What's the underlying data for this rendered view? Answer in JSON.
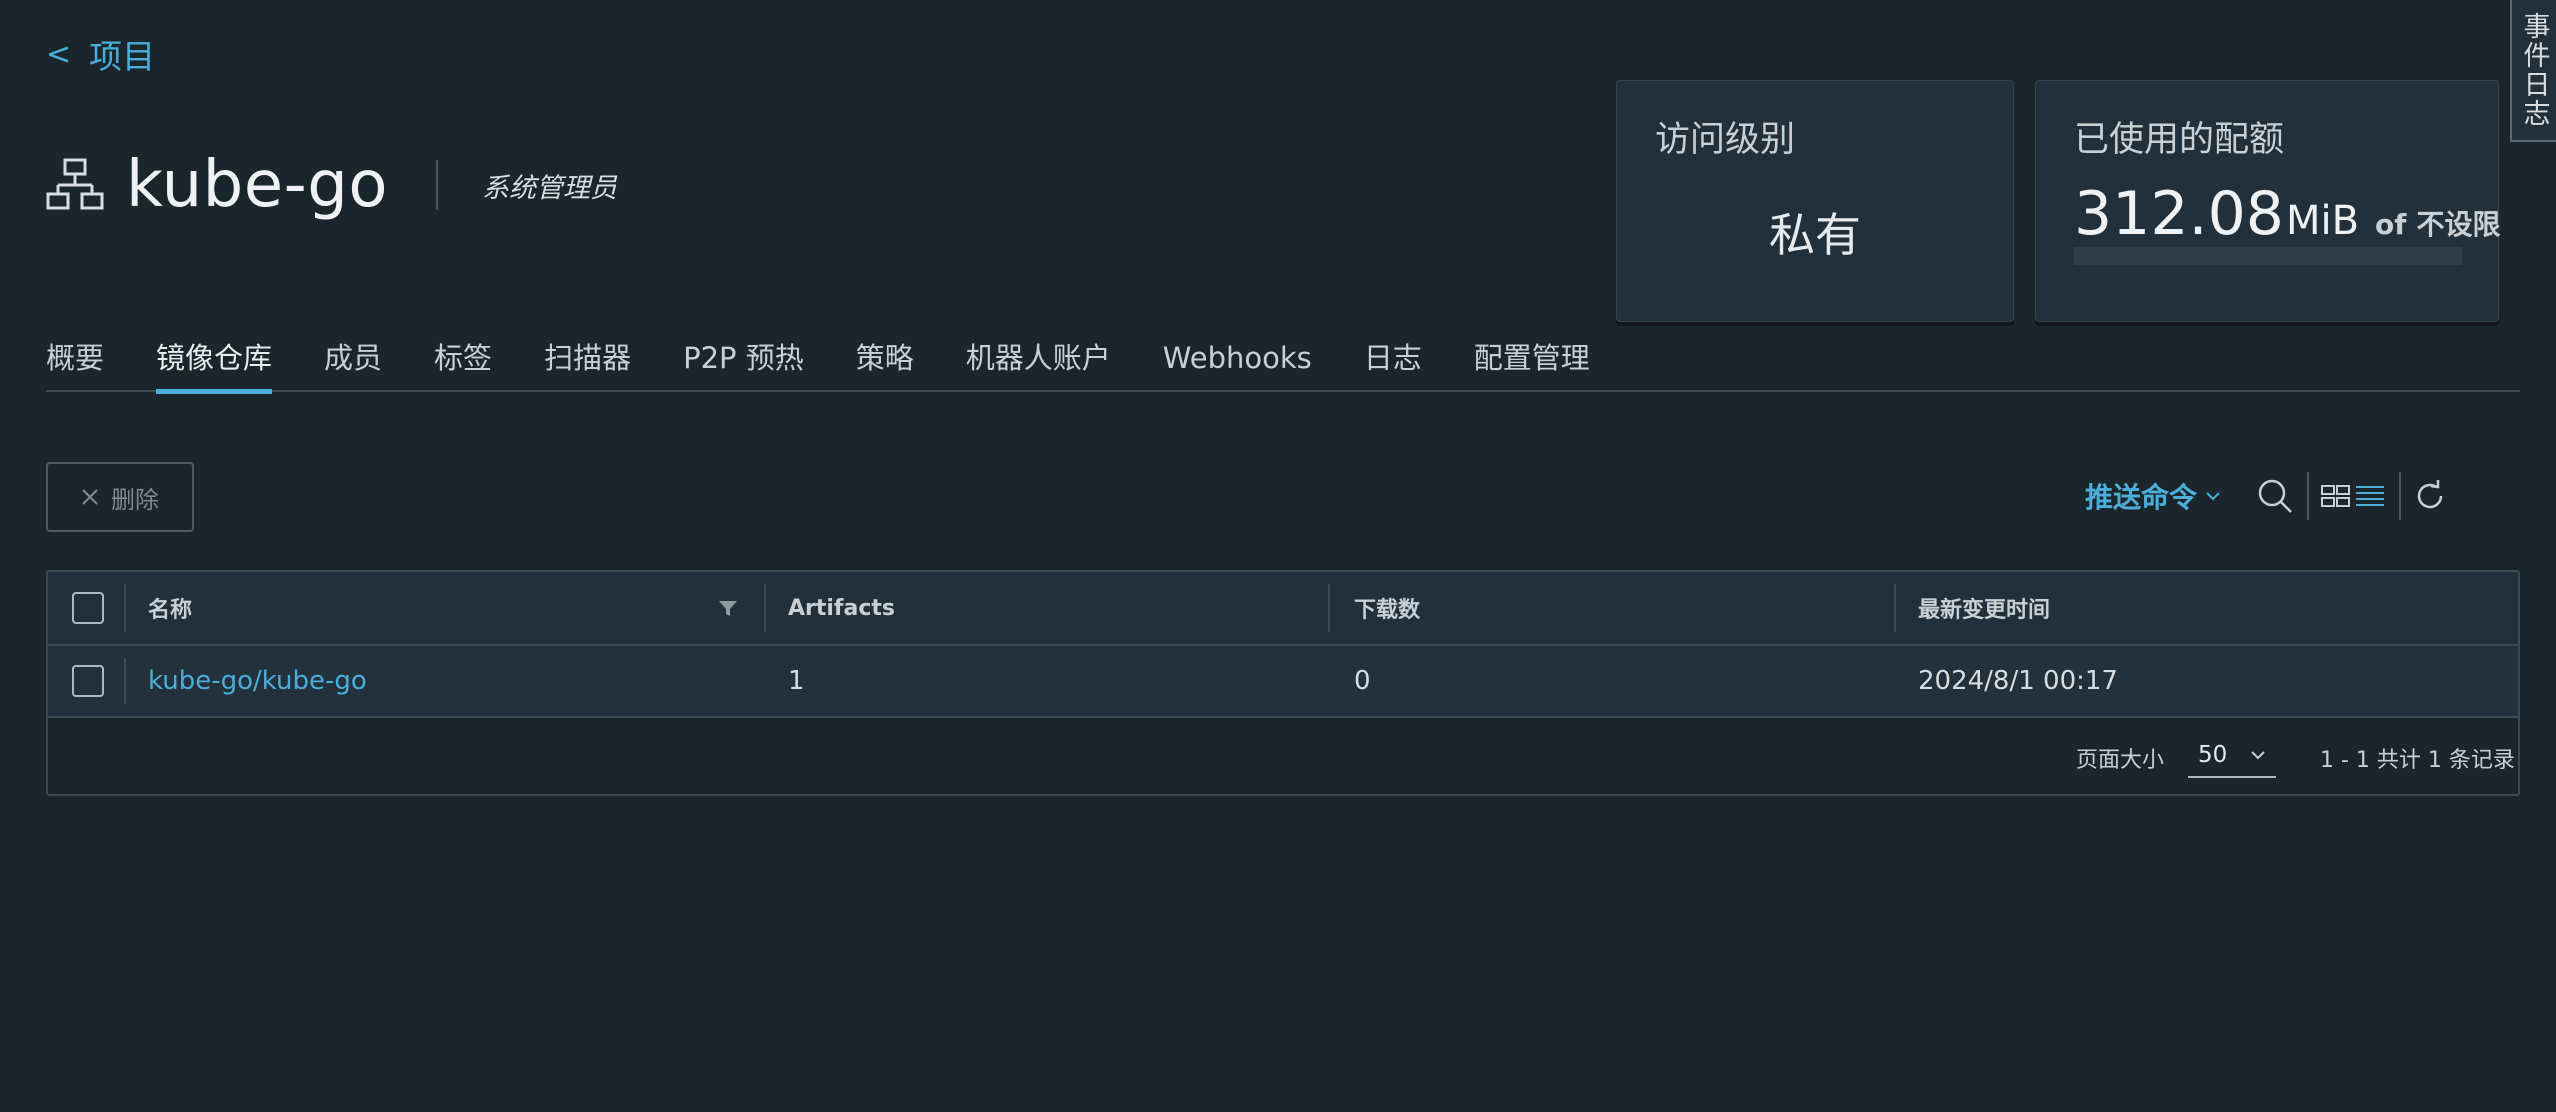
{
  "nav": {
    "back_chevron": "<",
    "back_label": "项目"
  },
  "project": {
    "icon": "project-tree-icon",
    "name": "kube-go",
    "role": "系统管理员"
  },
  "cards": {
    "access": {
      "title": "访问级别",
      "value": "私有"
    },
    "quota": {
      "title": "已使用的配额",
      "used": "312.08",
      "unit": "MiB",
      "of": "of",
      "limit": "不设限",
      "usage_fraction": 0
    }
  },
  "side_tab": {
    "label": "事件日志"
  },
  "tabs": [
    {
      "label": "概要",
      "active": false
    },
    {
      "label": "镜像仓库",
      "active": true
    },
    {
      "label": "成员",
      "active": false
    },
    {
      "label": "标签",
      "active": false
    },
    {
      "label": "扫描器",
      "active": false
    },
    {
      "label": "P2P 预热",
      "active": false
    },
    {
      "label": "策略",
      "active": false
    },
    {
      "label": "机器人账户",
      "active": false
    },
    {
      "label": "Webhooks",
      "active": false
    },
    {
      "label": "日志",
      "active": false
    },
    {
      "label": "配置管理",
      "active": false
    }
  ],
  "toolbar": {
    "delete_label": "删除",
    "push_command_label": "推送命令",
    "icons": [
      "search-icon",
      "card-view-icon",
      "list-view-icon",
      "refresh-icon"
    ]
  },
  "table": {
    "columns": [
      "名称",
      "Artifacts",
      "下载数",
      "最新变更时间"
    ],
    "rows": [
      {
        "name": "kube-go/kube-go",
        "artifacts": "1",
        "downloads": "0",
        "updated": "2024/8/1 00:17"
      }
    ],
    "footer": {
      "page_size_label": "页面大小",
      "page_size": "50",
      "count": "1 - 1 共计 1 条记录"
    }
  },
  "colors": {
    "background": "#1b252c",
    "accent": "#4aaed9",
    "card": "#21303a"
  }
}
